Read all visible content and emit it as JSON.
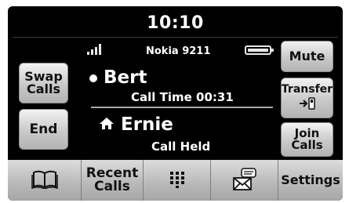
{
  "status": {
    "time": "10:10",
    "network": "Nokia 9211",
    "signal_icon": "signal-bars-icon",
    "battery_icon": "battery-icon"
  },
  "left_buttons": {
    "swap_calls": [
      "Swap",
      "Calls"
    ],
    "end": "End"
  },
  "right_buttons": {
    "mute": "Mute",
    "transfer": "Transfer",
    "transfer_icon": "phone-transfer-icon",
    "join_calls": [
      "Join",
      "Calls"
    ]
  },
  "calls": {
    "active": {
      "name": "Bert",
      "detail": "Call Time 00:31",
      "icon": "active-bullet-icon"
    },
    "held": {
      "name": "Ernie",
      "detail": "Call Held",
      "icon": "home-icon"
    }
  },
  "bottom_tabs": {
    "phonebook_icon": "phonebook-icon",
    "recent_calls": [
      "Recent",
      "Calls"
    ],
    "keypad_icon": "keypad-icon",
    "messages_icon": "messages-icon",
    "settings": "Settings"
  }
}
